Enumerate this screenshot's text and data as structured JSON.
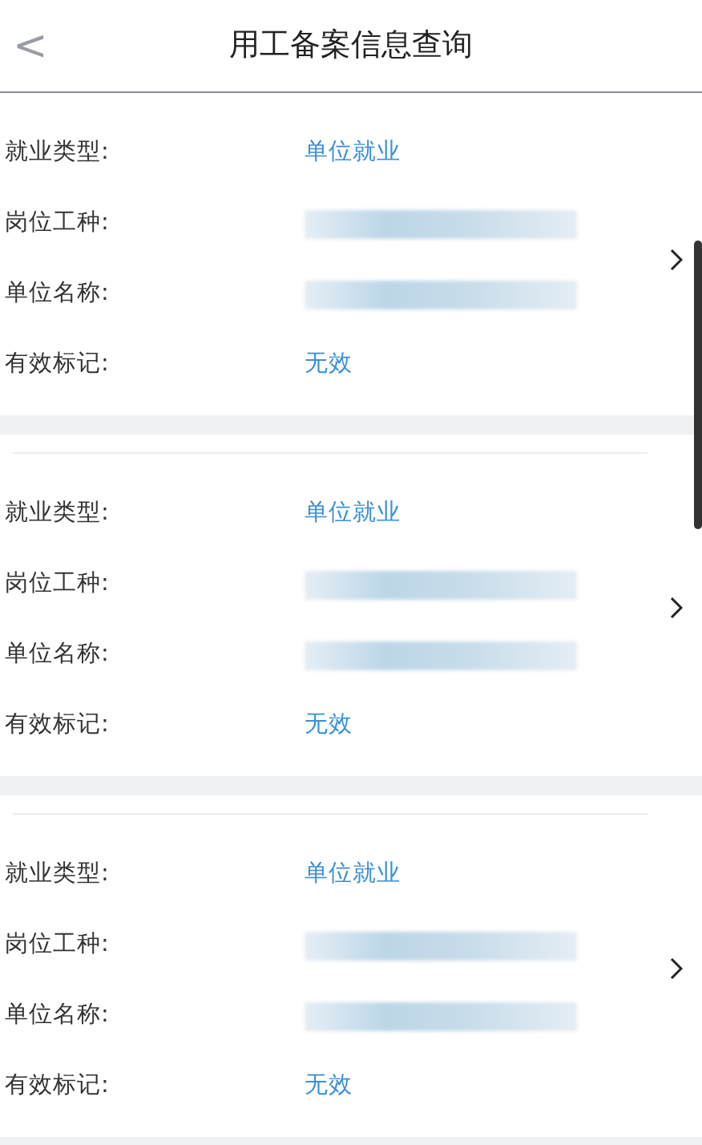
{
  "header": {
    "back": "<",
    "title": "用工备案信息查询"
  },
  "records": [
    {
      "fields": [
        {
          "label": "就业类型:",
          "kind": "text",
          "value": "单位就业"
        },
        {
          "label": "岗位工种:",
          "kind": "blurred"
        },
        {
          "label": "单位名称:",
          "kind": "blurred"
        },
        {
          "label": "有效标记:",
          "kind": "text",
          "value": "无效"
        }
      ]
    },
    {
      "fields": [
        {
          "label": "就业类型:",
          "kind": "text",
          "value": "单位就业"
        },
        {
          "label": "岗位工种:",
          "kind": "blurred"
        },
        {
          "label": "单位名称:",
          "kind": "blurred"
        },
        {
          "label": "有效标记:",
          "kind": "text",
          "value": "无效"
        }
      ]
    },
    {
      "fields": [
        {
          "label": "就业类型:",
          "kind": "text",
          "value": "单位就业"
        },
        {
          "label": "岗位工种:",
          "kind": "blurred"
        },
        {
          "label": "单位名称:",
          "kind": "blurred"
        },
        {
          "label": "有效标记:",
          "kind": "text",
          "value": "无效"
        }
      ]
    }
  ]
}
